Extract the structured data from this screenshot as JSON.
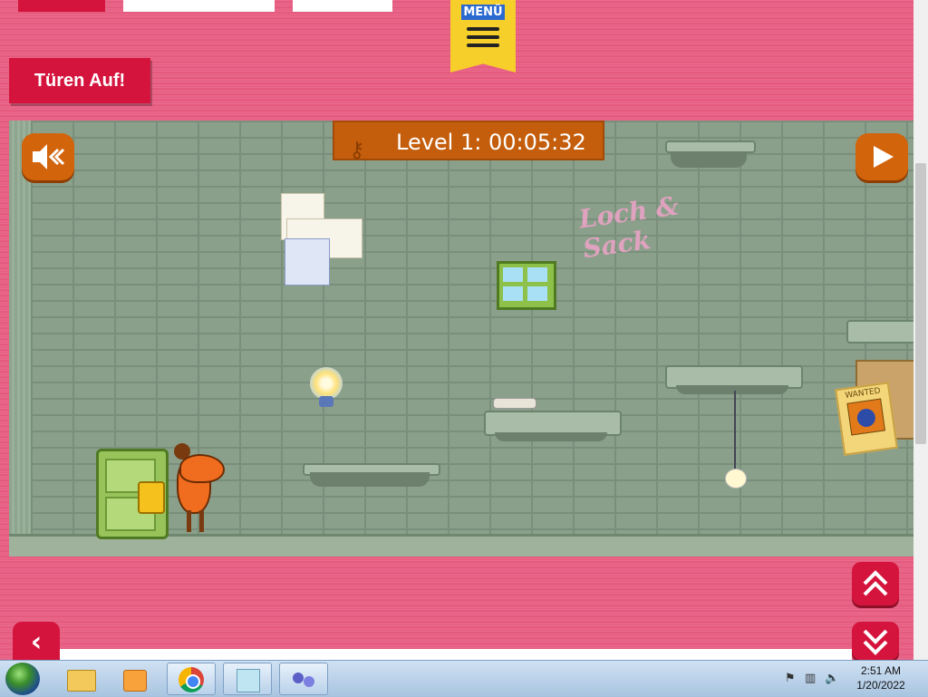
{
  "header": {
    "menu_label": "MENÜ",
    "doors_button": "Türen Auf!"
  },
  "game": {
    "level_text": "Level 1: 00:05:32",
    "graffiti_text": "Loch & Sack",
    "wanted_text": "WANTED",
    "sound_icon": "speaker-mute-icon",
    "play_icon": "play-icon"
  },
  "navigation": {
    "back_icon": "chevron-left-icon",
    "scroll_up_icon": "double-chevron-up-icon",
    "scroll_down_icon": "double-chevron-down-icon"
  },
  "taskbar": {
    "time": "2:51 AM",
    "date": "1/20/2022",
    "pinned": [
      "start-icon",
      "file-explorer-icon",
      "media-player-icon",
      "chrome-icon",
      "notepad-icon",
      "app-icon"
    ]
  },
  "colors": {
    "background_pink": "#e65a80",
    "button_red": "#d4143c",
    "banner_orange": "#c45e0c",
    "menu_yellow": "#f7cf2a",
    "wall_green": "#8ba08b"
  }
}
